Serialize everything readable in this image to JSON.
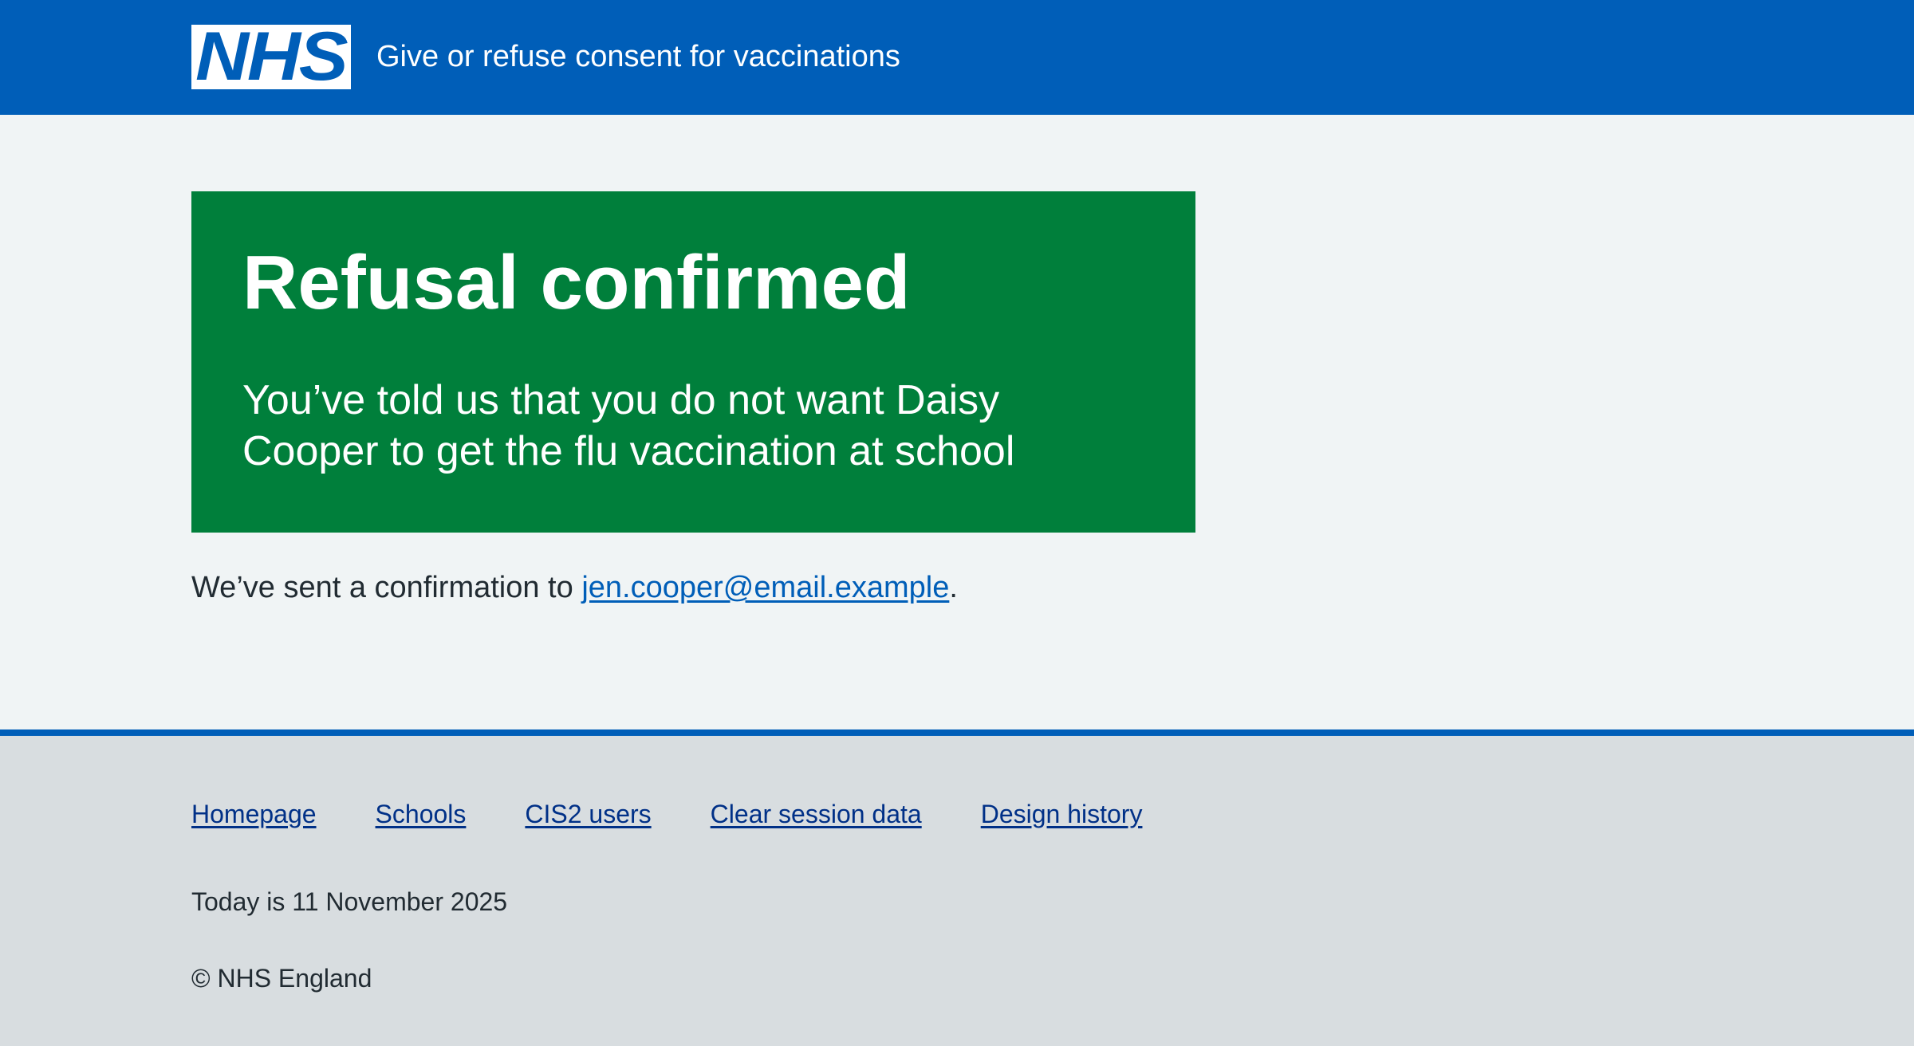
{
  "header": {
    "logo_text": "NHS",
    "service_name": "Give or refuse consent for vaccinations"
  },
  "panel": {
    "title": "Refusal confirmed",
    "body": "You’ve told us that you do not want Daisy Cooper to get the flu vaccination at school"
  },
  "confirmation": {
    "prefix": "We’ve sent a confirmation to ",
    "email": "jen.cooper@email.example",
    "suffix": "."
  },
  "footer": {
    "links": [
      "Homepage",
      "Schools",
      "CIS2 users",
      "Clear session data",
      "Design history"
    ],
    "today": "Today is 11 November 2025",
    "copyright": "© NHS England"
  },
  "colors": {
    "header_blue": "#005eb8",
    "panel_green": "#007f3b",
    "page_bg": "#f0f4f5",
    "footer_bg": "#d8dde0",
    "link_blue": "#005eb8",
    "footer_link": "#003087"
  }
}
